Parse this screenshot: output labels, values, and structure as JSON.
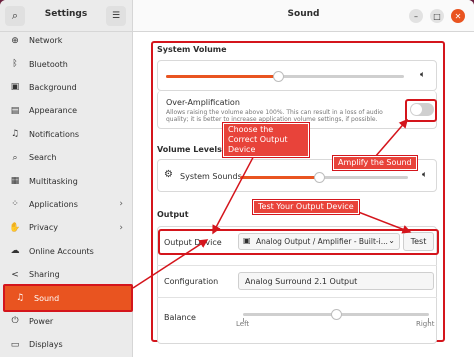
{
  "sidebar": {
    "title": "Settings",
    "items": [
      {
        "label": "Network",
        "icon": "network-icon",
        "glyph": "⊕"
      },
      {
        "label": "Bluetooth",
        "icon": "bluetooth-icon",
        "glyph": "ᛒ"
      },
      {
        "label": "Background",
        "icon": "background-icon",
        "glyph": "▣"
      },
      {
        "label": "Appearance",
        "icon": "appearance-icon",
        "glyph": "▤"
      },
      {
        "label": "Notifications",
        "icon": "bell-icon",
        "glyph": "♫"
      },
      {
        "label": "Search",
        "icon": "search-icon",
        "glyph": "⌕"
      },
      {
        "label": "Multitasking",
        "icon": "multitasking-icon",
        "glyph": "▦"
      },
      {
        "label": "Applications",
        "icon": "applications-icon",
        "glyph": "⁘"
      },
      {
        "label": "Privacy",
        "icon": "privacy-icon",
        "glyph": "✋"
      },
      {
        "label": "Online Accounts",
        "icon": "cloud-icon",
        "glyph": "☁"
      },
      {
        "label": "Sharing",
        "icon": "sharing-icon",
        "glyph": "<"
      },
      {
        "label": "Sound",
        "icon": "music-note-icon",
        "glyph": "♫"
      },
      {
        "label": "Power",
        "icon": "power-icon",
        "glyph": "⏻"
      },
      {
        "label": "Displays",
        "icon": "displays-icon",
        "glyph": "▭"
      }
    ]
  },
  "header": {
    "title": "Sound"
  },
  "system_volume": {
    "title": "System Volume",
    "level": 0.47
  },
  "over_amplification": {
    "label": "Over-Amplification",
    "description": "Allows raising the volume above 100%. This can result in a loss of audio quality; it is better to increase application volume settings, if possible.",
    "enabled": false
  },
  "volume_levels": {
    "title": "Volume Levels",
    "system_sounds_label": "System Sounds",
    "system_sounds_level": 0.47
  },
  "output": {
    "title": "Output",
    "device_label": "Output Device",
    "device_value": "Analog Output / Amplifier - Built-i...",
    "test_label": "Test",
    "configuration_label": "Configuration",
    "configuration_value": "Analog Surround 2.1 Output",
    "balance_label": "Balance",
    "balance_left": "Left",
    "balance_right": "Right",
    "balance_level": 0.5
  },
  "callouts": {
    "choose_device": "Choose the Correct Output Device",
    "amplify": "Amplify the Sound",
    "test_output": "Test Your Output Device"
  },
  "colors": {
    "accent": "#e95420",
    "annotation": "#d4151c"
  }
}
